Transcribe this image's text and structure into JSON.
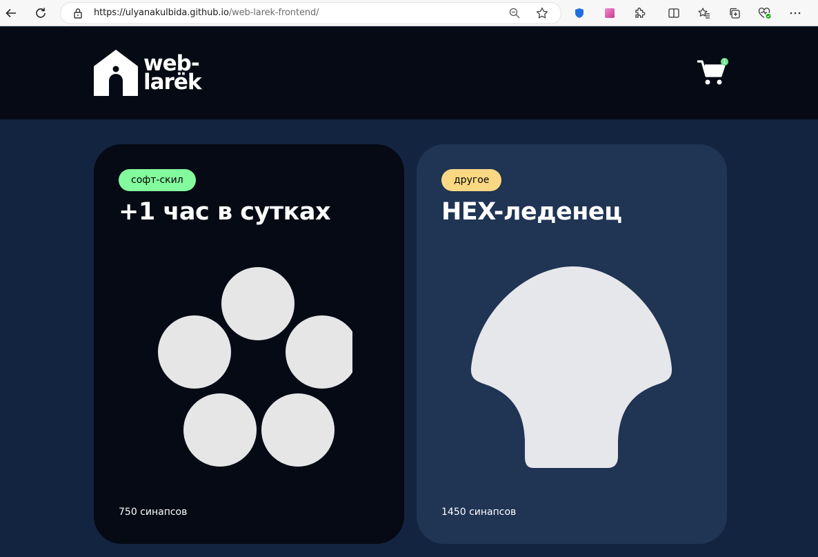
{
  "browser": {
    "url_host": "https://ulyanakulbida.github.io",
    "url_path": "/web-larek-frontend/"
  },
  "header": {
    "logo_line1": "web-",
    "logo_line2": "larëk",
    "cart_counter": "1"
  },
  "cards": [
    {
      "category": "софт-скил",
      "title": "+1 час в сутках",
      "price": "750 синапсов",
      "image": "five-circles"
    },
    {
      "category": "другое",
      "title": "HEX-леденец",
      "price": "1450 синапсов",
      "image": "shell-lollipop"
    }
  ],
  "colors": {
    "page_bg": "#132440",
    "header_bg": "#050a14",
    "card_dark": "#050a14",
    "card_light": "#203454",
    "category_soft": "#83fa9d",
    "category_other": "#fad883",
    "cart_badge": "#6ee38e"
  }
}
